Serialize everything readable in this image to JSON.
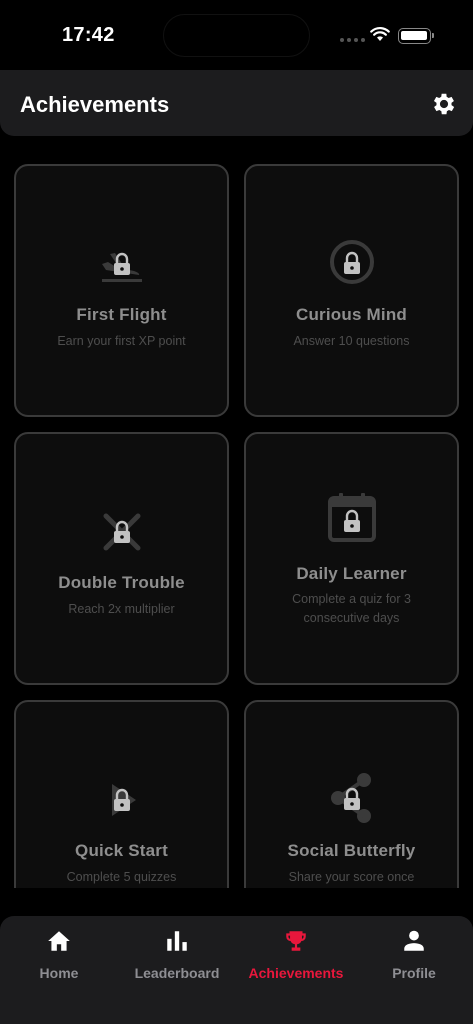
{
  "status_bar": {
    "time": "17:42"
  },
  "header": {
    "title": "Achievements"
  },
  "achievements": [
    {
      "title": "First Flight",
      "description": "Earn your first XP point",
      "icon": "plane-landing-icon"
    },
    {
      "title": "Curious Mind",
      "description": "Answer 10 questions",
      "icon": "ring-icon"
    },
    {
      "title": "Double Trouble",
      "description": "Reach 2x multiplier",
      "icon": "cross-icon"
    },
    {
      "title": "Daily Learner",
      "description": "Complete a quiz for 3 consecutive days",
      "icon": "calendar-icon"
    },
    {
      "title": "Quick Start",
      "description": "Complete 5 quizzes",
      "icon": "play-icon"
    },
    {
      "title": "Social Butterfly",
      "description": "Share your score once",
      "icon": "share-icon"
    }
  ],
  "tabs": [
    {
      "label": "Home",
      "icon": "home-icon",
      "active": false
    },
    {
      "label": "Leaderboard",
      "icon": "bar-chart-icon",
      "active": false
    },
    {
      "label": "Achievements",
      "icon": "trophy-icon",
      "active": true
    },
    {
      "label": "Profile",
      "icon": "person-icon",
      "active": false
    }
  ],
  "colors": {
    "accent": "#e8173c",
    "background": "#000000",
    "surface": "#1c1c1e",
    "card": "#0d0d0d",
    "card_border": "#3a3a3a"
  }
}
